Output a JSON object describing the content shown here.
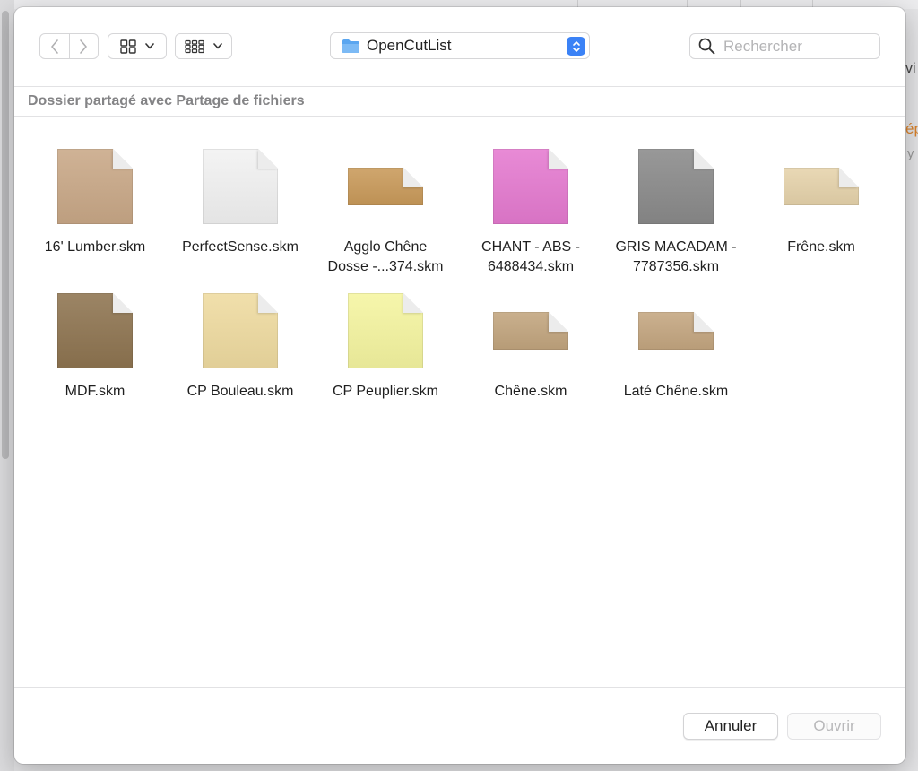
{
  "background": {
    "right_texts": [
      "vi",
      "ép",
      "y a"
    ]
  },
  "toolbar": {
    "back_icon": "chevron-left-icon",
    "forward_icon": "chevron-right-icon",
    "icon_view_icon": "grid-icon",
    "group_view_icon": "grid-small-icon",
    "current_folder": "OpenCutList",
    "search_placeholder": "Rechercher"
  },
  "section": {
    "title": "Dossier partagé avec Partage de fichiers"
  },
  "files": [
    {
      "name": "16' Lumber.skm",
      "color": "#c9a887",
      "shape": "tall"
    },
    {
      "name": "PerfectSense.skm",
      "color": "#f2f2f2",
      "shape": "tall"
    },
    {
      "name": "Agglo Chêne\nDosse -...374.skm",
      "color": "#c99a5a",
      "shape": "wide"
    },
    {
      "name": "CHANT - ABS -\n6488434.skm",
      "color": "#e57ad0",
      "shape": "tall"
    },
    {
      "name": "GRIS MACADAM -\n7787356.skm",
      "color": "#8a8a8a",
      "shape": "tall"
    },
    {
      "name": "Frêne.skm",
      "color": "#e6d3ab",
      "shape": "wide"
    },
    {
      "name": "MDF.skm",
      "color": "#8e7450",
      "shape": "tall"
    },
    {
      "name": "CP Bouleau.skm",
      "color": "#efdba0",
      "shape": "tall"
    },
    {
      "name": "CP Peuplier.skm",
      "color": "#f5f5a0",
      "shape": "tall"
    },
    {
      "name": "Chêne.skm",
      "color": "#c2a57e",
      "shape": "wide"
    },
    {
      "name": "Laté Chêne.skm",
      "color": "#c4a680",
      "shape": "wide"
    }
  ],
  "footer": {
    "cancel_label": "Annuler",
    "open_label": "Ouvrir"
  }
}
